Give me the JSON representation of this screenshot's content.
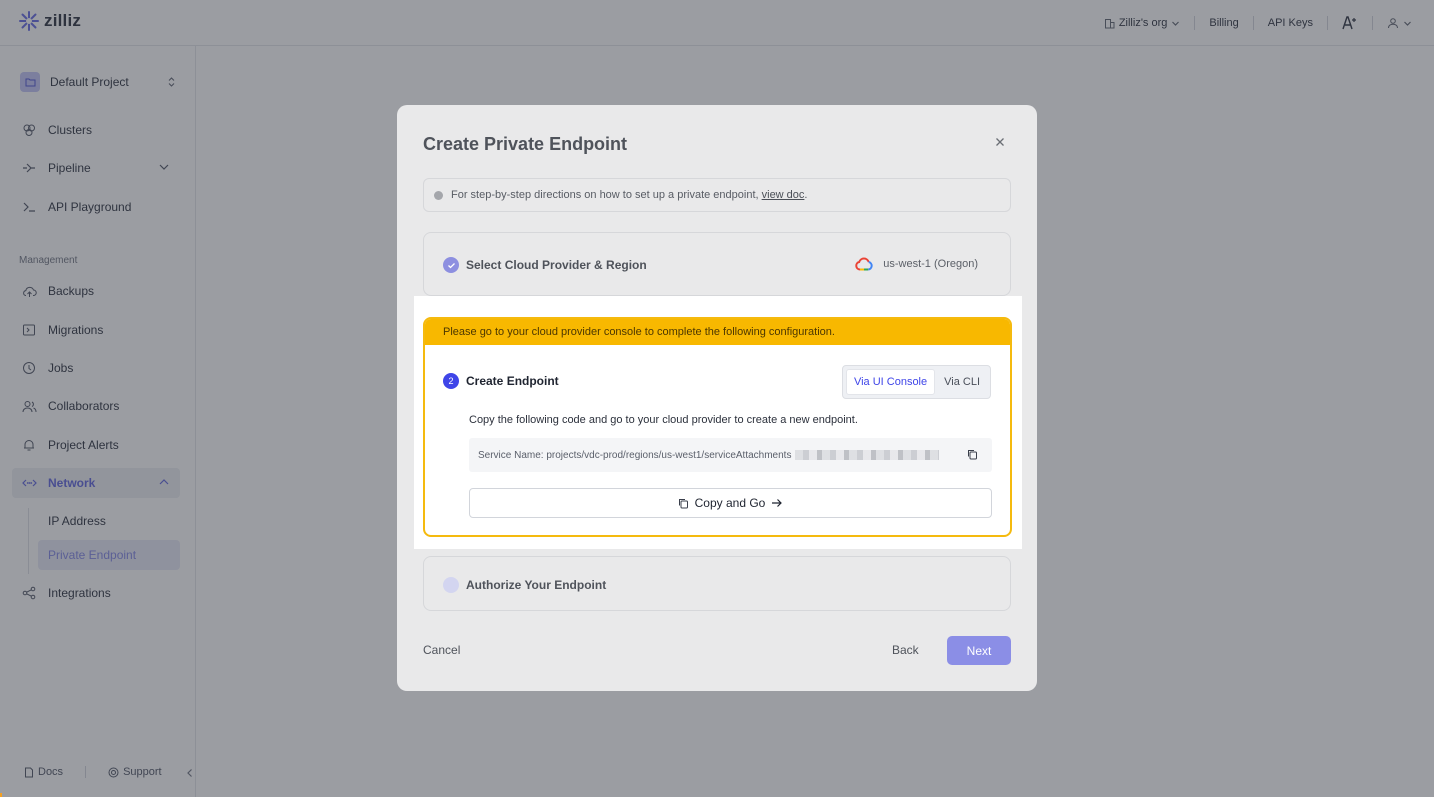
{
  "app": {
    "brand": "zilliz"
  },
  "topnav": {
    "org": "Zilliz's org",
    "billing": "Billing",
    "api_keys": "API Keys"
  },
  "sidebar": {
    "project": "Default Project",
    "items": [
      {
        "label": "Clusters",
        "icon": "clusters-icon"
      },
      {
        "label": "Pipeline",
        "icon": "pipeline-icon"
      },
      {
        "label": "API Playground",
        "icon": "terminal-icon"
      }
    ],
    "management_label": "Management",
    "management_items": [
      {
        "label": "Backups",
        "icon": "cloud-backup-icon"
      },
      {
        "label": "Migrations",
        "icon": "migrations-icon"
      },
      {
        "label": "Jobs",
        "icon": "jobs-icon"
      },
      {
        "label": "Collaborators",
        "icon": "collaborators-icon"
      },
      {
        "label": "Project Alerts",
        "icon": "alerts-icon"
      },
      {
        "label": "Network",
        "icon": "network-icon"
      }
    ],
    "network_sub": [
      {
        "label": "IP Address"
      },
      {
        "label": "Private Endpoint"
      }
    ],
    "integrations": "Integrations",
    "footer": {
      "docs": "Docs",
      "support": "Support"
    }
  },
  "modal": {
    "title": "Create Private Endpoint",
    "info_text": "For step-by-step directions on how to set up a private endpoint,",
    "info_link": "view doc",
    "info_after": ".",
    "step1": {
      "title": "Select Cloud Provider & Region",
      "region": "us-west-1 (Oregon)"
    },
    "step2": {
      "banner": "Please go to your cloud provider console to complete the following configuration.",
      "number": "2",
      "title": "Create Endpoint",
      "tabs": [
        "Via UI Console",
        "Via CLI"
      ],
      "active_tab": "Via UI Console",
      "instruction": "Copy the following code and go to your cloud provider to create a new endpoint.",
      "service_name": "Service Name: projects/vdc-prod/regions/us-west1/serviceAttachments",
      "copy_go": "Copy and Go"
    },
    "step3": {
      "title": "Authorize Your Endpoint"
    },
    "buttons": {
      "cancel": "Cancel",
      "back": "Back",
      "next": "Next"
    }
  },
  "colors": {
    "accent": "#3f45e8",
    "warning": "#f8b800",
    "next_button": "#8b8ee6"
  }
}
